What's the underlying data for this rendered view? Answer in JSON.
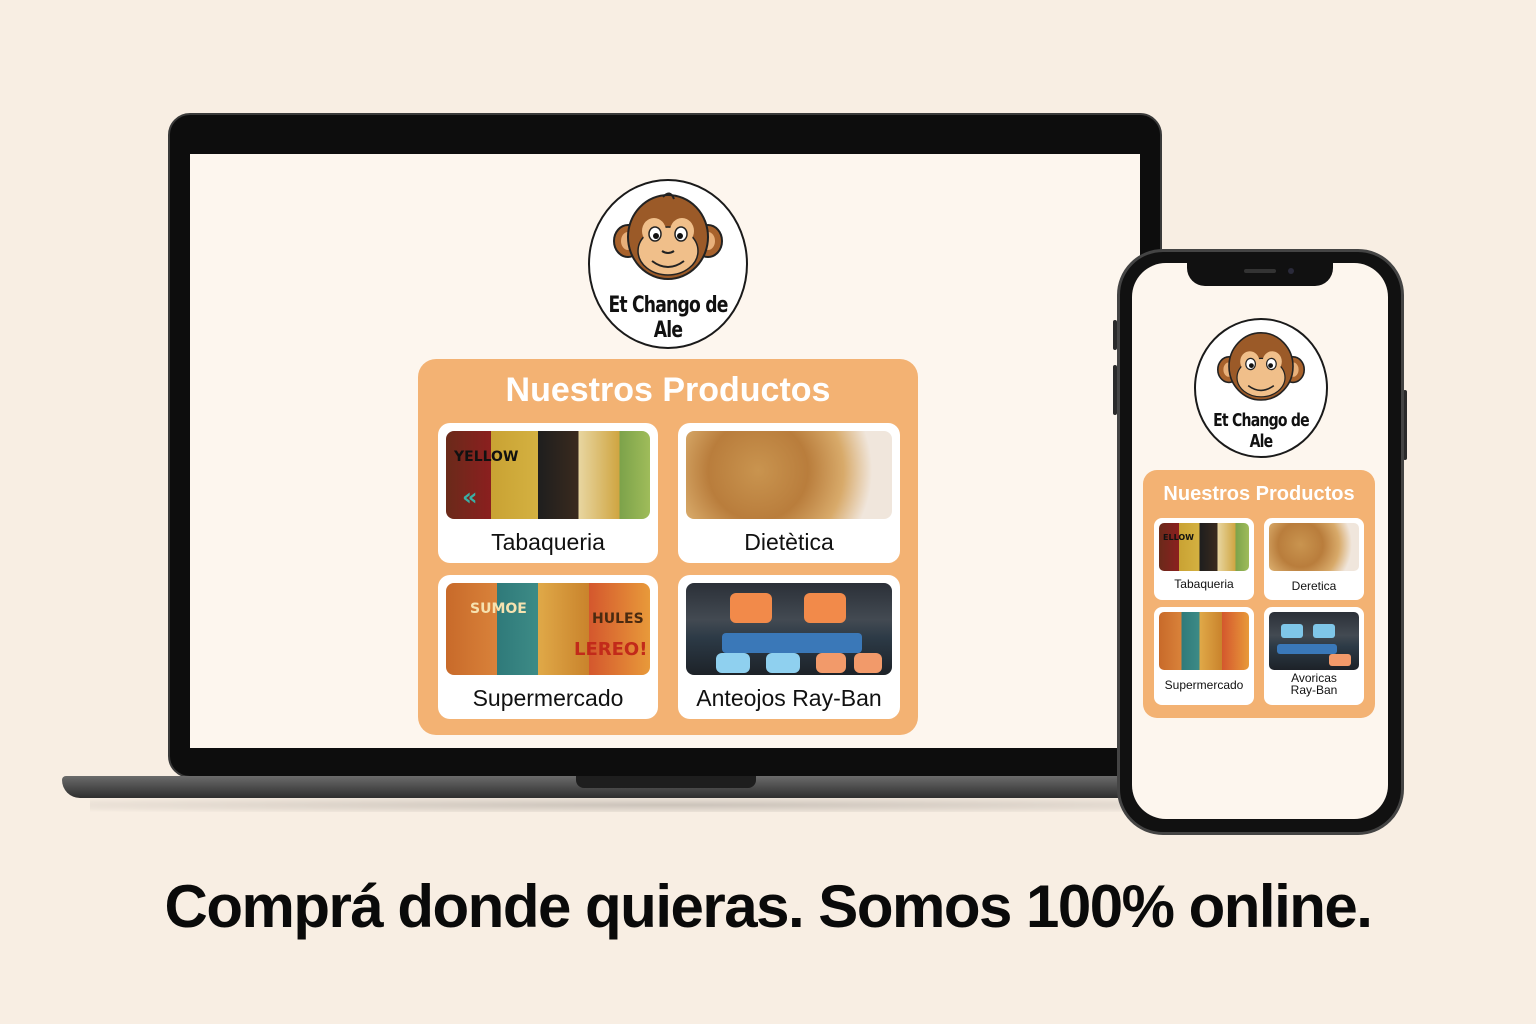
{
  "brand": {
    "name": "Et Chango de Ale"
  },
  "laptop": {
    "section_title": "Nuestros Productos",
    "products": [
      {
        "label": "Tabaqueria"
      },
      {
        "label": "Dietètica"
      },
      {
        "label": "Supermercado"
      },
      {
        "label": "Anteojos Ray-Ban"
      }
    ]
  },
  "phone": {
    "section_title": "Nuestros Productos",
    "products": [
      {
        "label": "Tabaqueria"
      },
      {
        "label": "Deretica"
      },
      {
        "label": "Supermercado"
      },
      {
        "label": "Avoricas\nRay-Ban"
      }
    ]
  },
  "caption": "Comprá donde quieras. Somos 100% online.",
  "colors": {
    "panel": "#f3b273",
    "page_bg": "#f8eee3",
    "screen_bg": "#fdf6ee"
  }
}
